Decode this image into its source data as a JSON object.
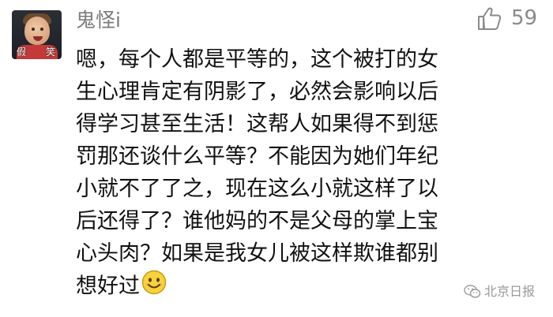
{
  "comment": {
    "username": "鬼怪i",
    "likes": "59",
    "avatar_caption_left": "假",
    "avatar_caption_right": "笑",
    "lines": [
      "嗯，每个人都是平等的，这个被打的女",
      "生心理肯定有阴影了，必然会影响以后",
      "得学习甚至生活！这帮人如果得不到惩",
      "罚那还谈什么平等？不能因为她们年纪",
      "小就不了了之，现在这么小就这样了以",
      "后还得了？谁他妈的不是父母的掌上宝",
      "心头肉？如果是我女儿被这样欺谁都别",
      "想好过"
    ],
    "emoji": "smiling-face-emoji",
    "icons": {
      "like": "thumbs-up-icon",
      "watermark": "wechat-logo-icon"
    }
  },
  "watermark": {
    "text": "北京日报"
  },
  "colors": {
    "username": "#7c7c7c",
    "text": "#111111",
    "like": "#8a8a8a",
    "watermark": "#9a9a9a"
  }
}
